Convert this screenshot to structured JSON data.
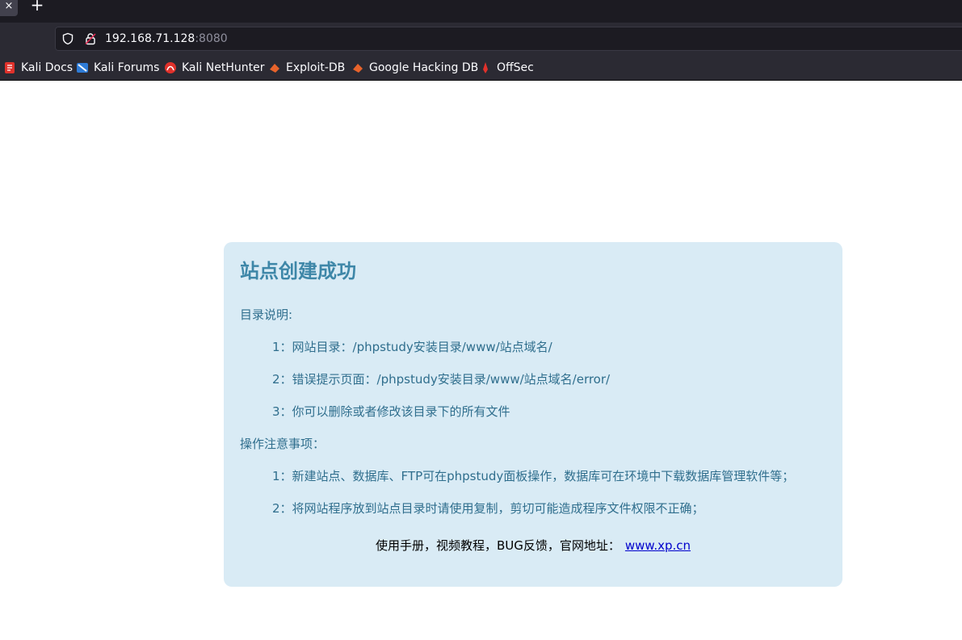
{
  "browser": {
    "tab_close_glyph": "×",
    "new_tab_glyph": "+",
    "url_host": "192.168.71.128",
    "url_port": ":8080",
    "bookmarks": [
      {
        "label": "Kali Docs",
        "icon": "kali-docs-icon",
        "color": "#e0312b"
      },
      {
        "label": "Kali Forums",
        "icon": "kali-forums-icon",
        "color": "#2e7bd6"
      },
      {
        "label": "Kali NetHunter",
        "icon": "kali-nethunter-icon",
        "color": "#e0312b"
      },
      {
        "label": "Exploit-DB",
        "icon": "exploit-db-icon",
        "color": "#e8632b"
      },
      {
        "label": "Google Hacking DB",
        "icon": "ghdb-icon",
        "color": "#e8632b"
      },
      {
        "label": "OffSec",
        "icon": "offsec-icon",
        "color": "#e0312b"
      }
    ]
  },
  "page": {
    "title": "站点创建成功",
    "dir_heading": "目录说明:",
    "dir_items": [
      "1：网站目录：/phpstudy安装目录/www/站点域名/",
      "2：错误提示页面：/phpstudy安装目录/www/站点域名/error/",
      "3：你可以删除或者修改该目录下的所有文件"
    ],
    "ops_heading": "操作注意事项：",
    "ops_items": [
      "1：新建站点、数据库、FTP可在phpstudy面板操作，数据库可在环境中下载数据库管理软件等；",
      "2：将网站程序放到站点目录时请使用复制，剪切可能造成程序文件权限不正确；"
    ],
    "footer_text": "使用手册，视频教程，BUG反馈，官网地址：",
    "footer_link": "www.xp.cn"
  },
  "colors": {
    "panel_bg": "#d9ebf5",
    "title": "#3e87a8",
    "body_text": "#2f6e8d",
    "link": "#0000cc"
  }
}
